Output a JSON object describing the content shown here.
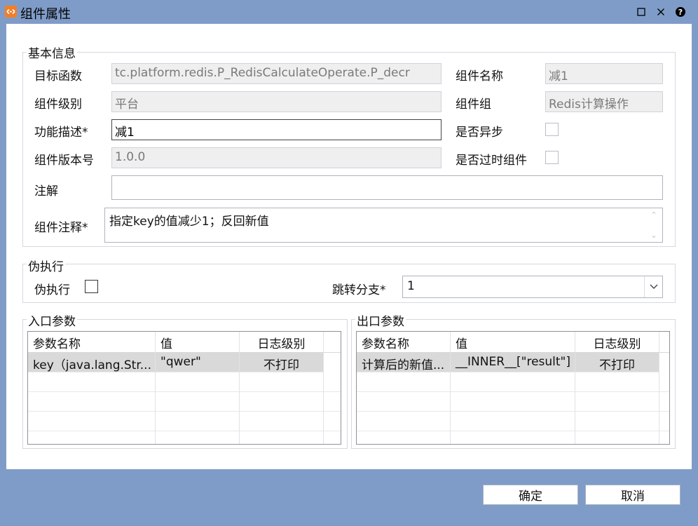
{
  "window": {
    "title": "组件属性",
    "controls": [
      "maximize-icon",
      "close-icon",
      "help-icon"
    ]
  },
  "basic_info": {
    "group_label": "基本信息",
    "target_function_label": "目标函数",
    "target_function_value": "tc.platform.redis.P_RedisCalculateOperate.P_decr",
    "component_name_label": "组件名称",
    "component_name_value": "减1",
    "component_level_label": "组件级别",
    "component_level_value": "平台",
    "component_group_label": "组件组",
    "component_group_value": "Redis计算操作",
    "function_desc_label": "功能描述*",
    "function_desc_value": "减1",
    "async_label": "是否异步",
    "async_checked": false,
    "version_label": "组件版本号",
    "version_value": "1.0.0",
    "obsolete_label": "是否过时组件",
    "obsolete_checked": false,
    "annotation_label": "注解",
    "annotation_value": "",
    "comment_label": "组件注释*",
    "comment_value": "指定key的值减少1；反回新值"
  },
  "pseudo_exec": {
    "group_label": "伪执行",
    "checkbox_label": "伪执行",
    "checked": false,
    "branch_label": "跳转分支*",
    "branch_value": "1"
  },
  "input_params": {
    "group_label": "入口参数",
    "columns": [
      "参数名称",
      "值",
      "日志级别"
    ],
    "rows": [
      [
        "key（java.lang.Str...",
        "\"qwer\"",
        "不打印"
      ]
    ]
  },
  "output_params": {
    "group_label": "出口参数",
    "columns": [
      "参数名称",
      "值",
      "日志级别"
    ],
    "rows": [
      [
        "计算后的新值...",
        "__INNER__[\"result\"]",
        "不打印"
      ]
    ]
  },
  "buttons": {
    "ok": "确定",
    "cancel": "取消"
  }
}
